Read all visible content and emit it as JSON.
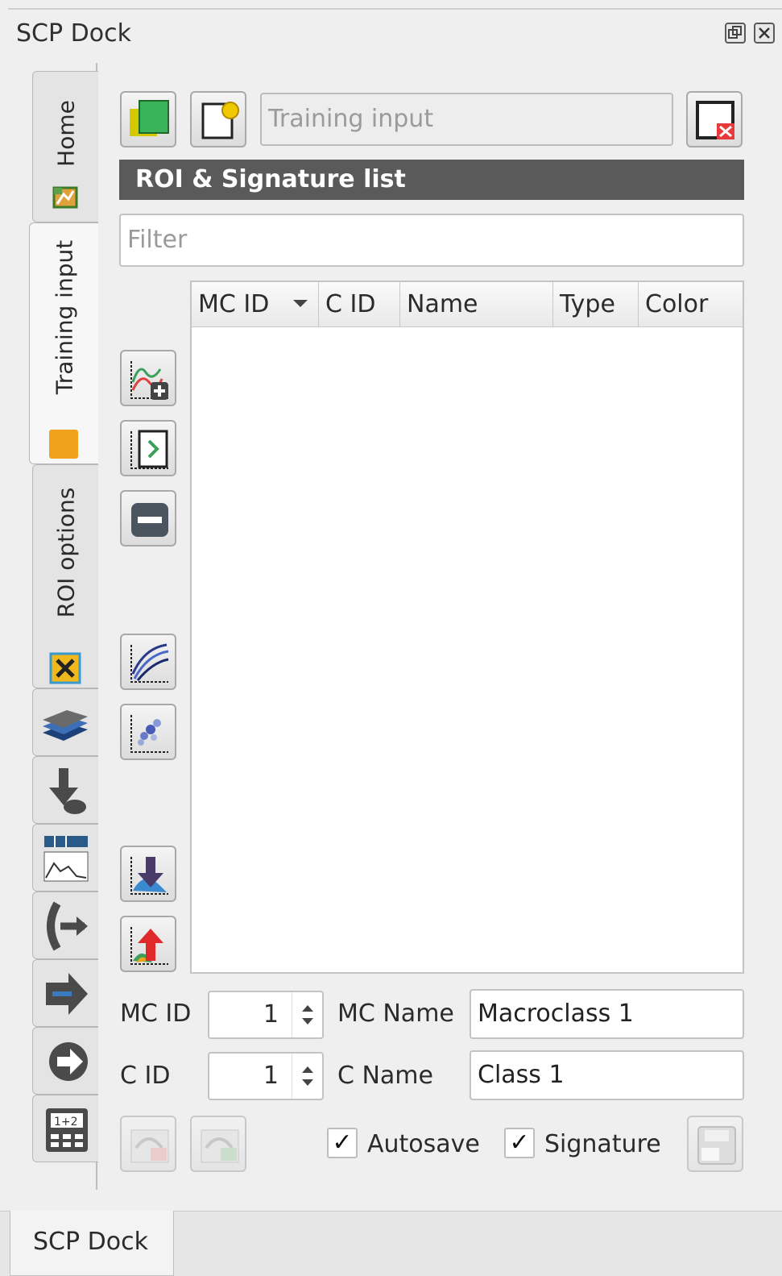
{
  "dock": {
    "title": "SCP Dock",
    "float_icon": "float-icon",
    "close_icon": "close-icon"
  },
  "vertical_tabs": [
    {
      "label": "Home",
      "icon": "home-map-icon",
      "active": false
    },
    {
      "label": "Training input",
      "icon": "orange-square-icon",
      "active": true
    },
    {
      "label": "ROI options",
      "icon": "tools-icon",
      "active": false
    },
    {
      "icon": "layers-icon"
    },
    {
      "icon": "download-icon"
    },
    {
      "icon": "histogram-icon"
    },
    {
      "icon": "export-icon"
    },
    {
      "icon": "arrow-band-icon"
    },
    {
      "icon": "postprocess-icon"
    },
    {
      "icon": "calculator-icon"
    }
  ],
  "toolbar": {
    "new_training_input_icon": "new-training-input-icon",
    "open_training_input_icon": "open-training-input-icon",
    "training_input_placeholder": "Training input",
    "reset_training_input_icon": "reset-input-icon"
  },
  "section": {
    "title": "ROI & Signature list"
  },
  "filter": {
    "placeholder": "Filter"
  },
  "table": {
    "columns": [
      "MC ID",
      "C ID",
      "Name",
      "Type",
      "Color"
    ],
    "sorted_column": "MC ID",
    "rows": []
  },
  "side_buttons": [
    "add-signature-icon",
    "merge-signatures-icon",
    "remove-icon",
    "spectral-plot-icon",
    "scatter-plot-icon",
    "import-icon",
    "export-signature-icon"
  ],
  "form": {
    "mc_id_label": "MC ID",
    "mc_id_value": "1",
    "mc_name_label": "MC Name",
    "mc_name_value": "Macroclass 1",
    "c_id_label": "C ID",
    "c_id_value": "1",
    "c_name_label": "C Name",
    "c_name_value": "Class 1"
  },
  "bottom_bar": {
    "undo_icon": "undo-roi-icon",
    "redo_icon": "redo-roi-icon",
    "autosave_label": "Autosave",
    "autosave_checked": true,
    "signature_label": "Signature",
    "signature_checked": true,
    "check_mark": "✓",
    "save_icon": "save-roi-icon"
  },
  "bottom_tab": {
    "label": "SCP Dock"
  }
}
